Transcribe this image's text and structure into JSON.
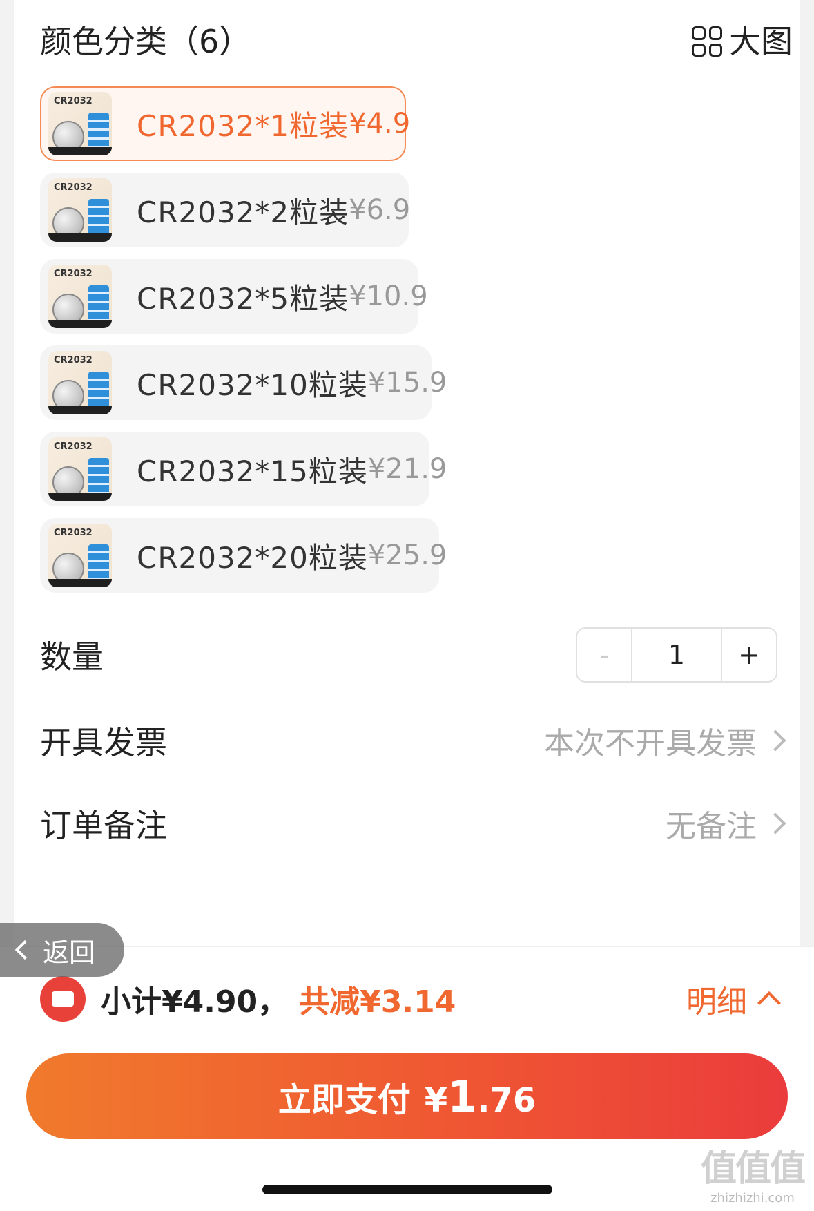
{
  "header": {
    "title": "颜色分类（6）",
    "big_pic_label": "大图"
  },
  "variants": [
    {
      "thumb_text": "CR2032",
      "name": "CR2032*1粒装",
      "price": "¥4.9",
      "selected": true
    },
    {
      "thumb_text": "CR2032",
      "name": "CR2032*2粒装",
      "price": "¥6.9",
      "selected": false
    },
    {
      "thumb_text": "CR2032",
      "name": "CR2032*5粒装",
      "price": "¥10.9",
      "selected": false
    },
    {
      "thumb_text": "CR2032",
      "name": "CR2032*10粒装",
      "price": "¥15.9",
      "selected": false
    },
    {
      "thumb_text": "CR2032",
      "name": "CR2032*15粒装",
      "price": "¥21.9",
      "selected": false
    },
    {
      "thumb_text": "CR2032",
      "name": "CR2032*20粒装",
      "price": "¥25.9",
      "selected": false
    }
  ],
  "quantity": {
    "label": "数量",
    "minus": "-",
    "value": "1",
    "plus": "+"
  },
  "invoice": {
    "label": "开具发票",
    "value": "本次不开具发票"
  },
  "note": {
    "label": "订单备注",
    "value": "无备注"
  },
  "back_button": {
    "label": "返回"
  },
  "summary": {
    "subtotal": "小计¥4.90，",
    "discount": "共减¥3.14",
    "detail": "明细"
  },
  "pay": {
    "label": "立即支付",
    "currency": "¥",
    "amount_int": "1",
    "amount_dec": ".76"
  },
  "watermark": {
    "big": "值值值",
    "small": "zhizhizhi.com"
  },
  "colors": {
    "accent": "#f0682f",
    "pay_gradient_start": "#f07a2c",
    "pay_gradient_end": "#ea3c3c"
  }
}
